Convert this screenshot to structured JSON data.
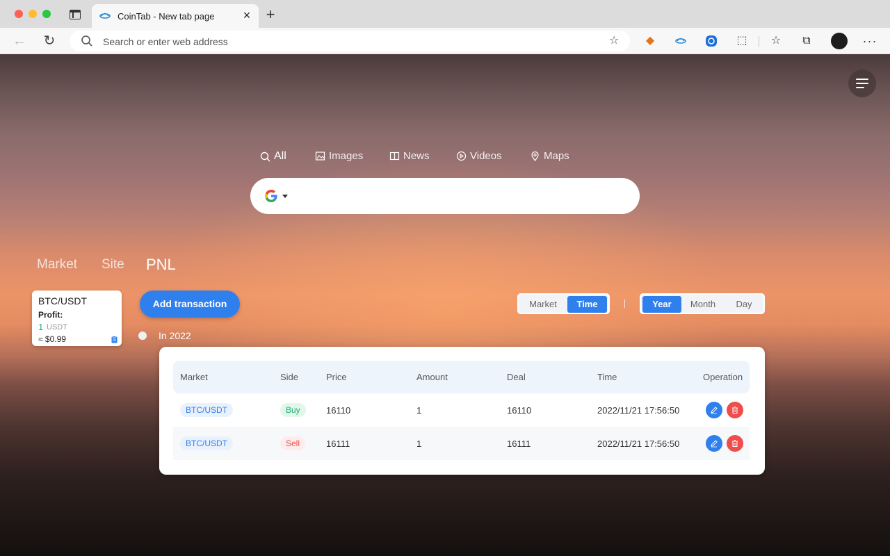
{
  "browser": {
    "tab_title": "CoinTab - New tab page",
    "address_placeholder": "Search or enter web address"
  },
  "search": {
    "tabs": [
      {
        "label": "All",
        "active": true
      },
      {
        "label": "Images",
        "active": false
      },
      {
        "label": "News",
        "active": false
      },
      {
        "label": "Videos",
        "active": false
      },
      {
        "label": "Maps",
        "active": false
      }
    ]
  },
  "sections": {
    "tabs": [
      {
        "label": "Market",
        "active": false
      },
      {
        "label": "Site",
        "active": false
      },
      {
        "label": "PNL",
        "active": true
      }
    ]
  },
  "pair_card": {
    "pair": "BTC/USDT",
    "profit_label": "Profit:",
    "profit_value": "1",
    "profit_unit": "USDT",
    "usd_value": "≈ $0.99"
  },
  "actions": {
    "add_transaction": "Add transaction"
  },
  "grouping": {
    "mode_options": [
      {
        "label": "Market",
        "selected": false
      },
      {
        "label": "Time",
        "selected": true
      }
    ],
    "divider": "|",
    "period_options": [
      {
        "label": "Year",
        "selected": true
      },
      {
        "label": "Month",
        "selected": false
      },
      {
        "label": "Day",
        "selected": false
      }
    ]
  },
  "timeline": {
    "label": "In 2022"
  },
  "transactions": {
    "columns": [
      "Market",
      "Side",
      "Price",
      "Amount",
      "Deal",
      "Time",
      "Operation"
    ],
    "rows": [
      {
        "market": "BTC/USDT",
        "side": "Buy",
        "price": "16110",
        "amount": "1",
        "deal": "16110",
        "time": "2022/11/21 17:56:50"
      },
      {
        "market": "BTC/USDT",
        "side": "Sell",
        "price": "16111",
        "amount": "1",
        "deal": "16111",
        "time": "2022/11/21 17:56:50"
      }
    ]
  },
  "colors": {
    "accent": "#2f80ed",
    "buy": "#18b26b",
    "sell": "#ef4c4c"
  },
  "icons": {
    "browser": [
      "back-icon",
      "reload-icon",
      "search-icon",
      "favorite-add-icon",
      "metamask-fox-icon",
      "cointab-icon",
      "blue-extension-icon",
      "puzzle-icon",
      "favorites-icon",
      "collections-icon",
      "profile-avatar",
      "more-icon"
    ],
    "page": [
      "menu-icon",
      "google-icon",
      "clipboard-icon",
      "edit-icon",
      "delete-icon"
    ]
  }
}
